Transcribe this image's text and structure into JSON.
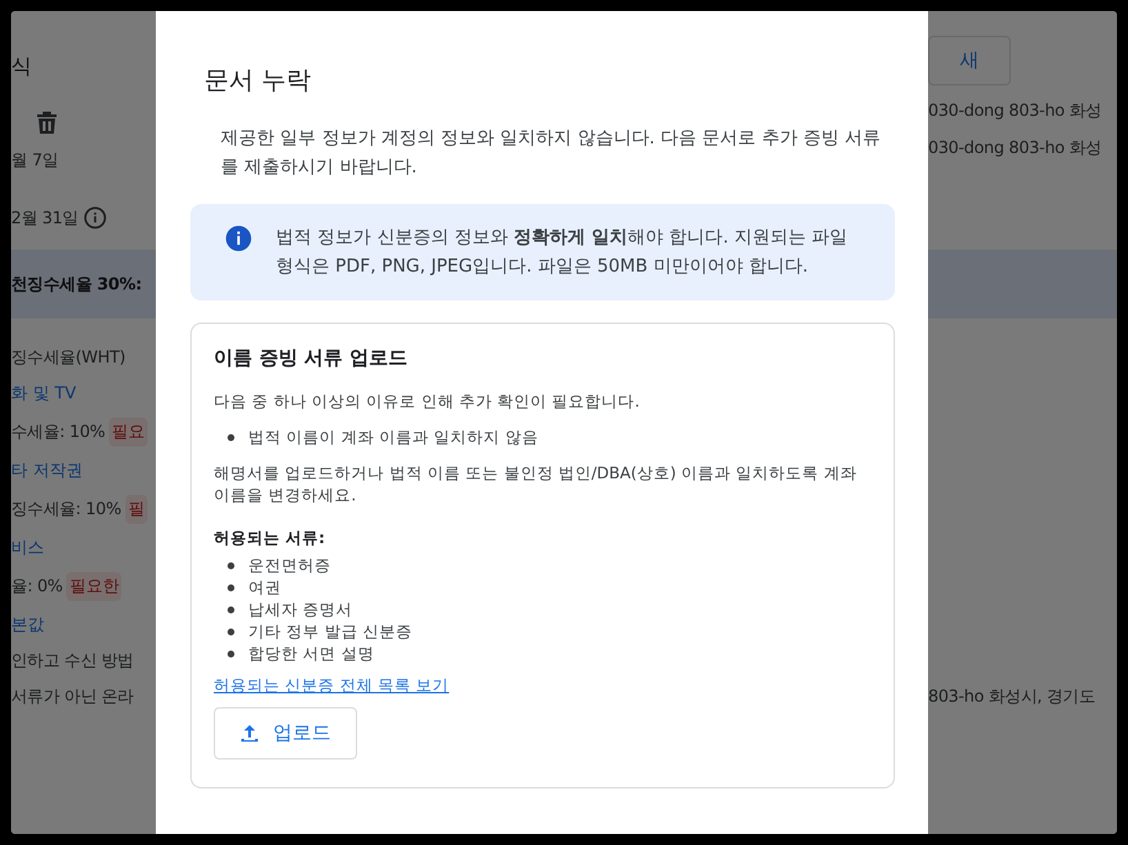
{
  "background_page": {
    "top_left": [
      {
        "kind": "heading",
        "text": "식"
      },
      {
        "kind": "trash"
      },
      {
        "kind": "text",
        "text": "월 7일"
      },
      {
        "kind": "date_info",
        "text": "2월 31일"
      }
    ],
    "top_right": [
      {
        "kind": "button",
        "text": "새 "
      },
      {
        "kind": "text",
        "text": "030-dong 803-ho 화성"
      },
      {
        "kind": "text",
        "text": "030-dong 803-ho 화성"
      }
    ],
    "banner": {
      "text": "천징수세율 30%:"
    },
    "bottom_left": [
      {
        "kind": "section_title",
        "text": "징수세율(WHT)"
      },
      {
        "kind": "link",
        "text": "화 및 TV"
      },
      {
        "kind": "rate",
        "text": "수세율: 10%",
        "badge": "필요"
      },
      {
        "kind": "link",
        "text": "타 저작권"
      },
      {
        "kind": "rate",
        "text": "징수세율: 10%",
        "badge": "필"
      },
      {
        "kind": "link",
        "text": "비스"
      },
      {
        "kind": "rate",
        "text": "율: 0%",
        "badge": "필요한"
      },
      {
        "kind": "link",
        "text": "본값"
      },
      {
        "kind": "text",
        "text": "인하고 수신 방법"
      },
      {
        "kind": "text",
        "text": "서류가 아닌 온라"
      }
    ],
    "bottom_right": [
      {
        "kind": "text",
        "text": "803-ho 화성시, 경기도"
      }
    ]
  },
  "dialog": {
    "title": "문서 누락",
    "intro": "제공한 일부 정보가 계정의 정보와 일치하지 않습니다. 다음 문서로 추가 증빙 서류를 제출하시기 바랍니다.",
    "notice": "법적 정보가 신분증의 정보와 **정확하게 일치**해야 합니다. 지원되는 파일 형식은 PDF, PNG, JPEG입니다. 파일은 50MB 미만이어야 합니다.",
    "card": {
      "title": "이름 증빙 서류 업로드",
      "reason_intro": "다음 중 하나 이상의 이유로 인해 추가 확인이 필요합니다.",
      "reasons": [
        "법적 이름이 계좌 이름과 일치하지 않음"
      ],
      "instruction": "해명서를 업로드하거나 법적 이름 또는 불인정 법인/DBA(상호) 이름과 일치하도록 계좌 이름을 변경하세요.",
      "accepted_title": "허용되는 서류:",
      "accepted": [
        "운전면허증",
        "여권",
        "납세자 증명서",
        "기타 정부 발급 신분증",
        "합당한 서면 설명"
      ],
      "link": "허용되는 신분증 전체 목록 보기",
      "upload_button": "업로드"
    }
  }
}
